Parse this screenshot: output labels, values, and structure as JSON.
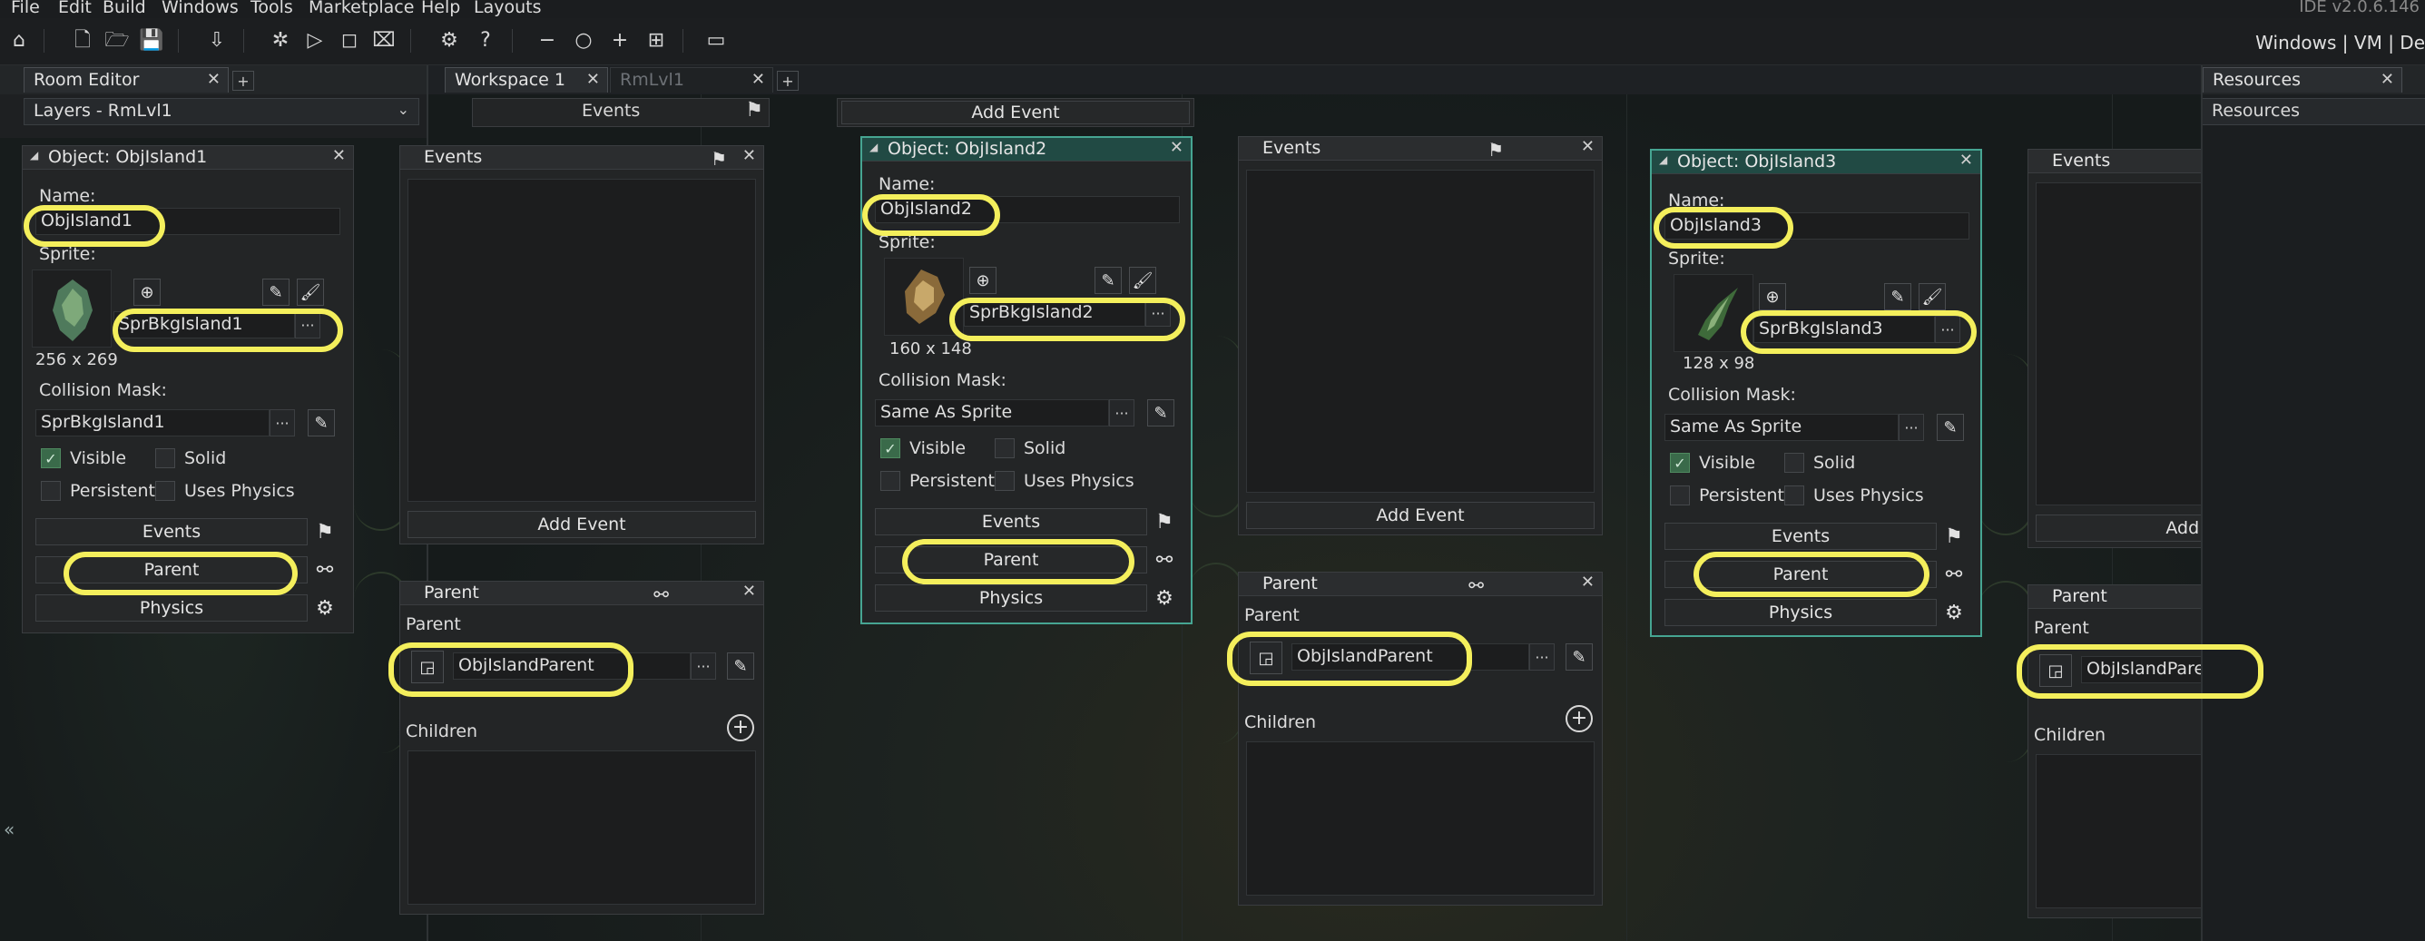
{
  "menu": {
    "items": [
      "File",
      "Edit",
      "Build",
      "Windows",
      "Tools",
      "Marketplace",
      "Help",
      "Layouts"
    ],
    "version": "IDE v2.0.6.146"
  },
  "toolbar": {
    "target": "Windows | VM | De"
  },
  "left_panel": {
    "tab_label": "Room Editor",
    "tab_add": "+",
    "layers_label": "Layers - RmLvl1",
    "collapse_glyph": "«"
  },
  "workspace_tabs": [
    {
      "label": "Workspace 1",
      "active": true
    },
    {
      "label": "RmLvl1",
      "active": false
    }
  ],
  "workspace_tab_add": "+",
  "resources": {
    "tab_label": "Resources",
    "header": "Resources"
  },
  "top_strips": {
    "events_label": "Events",
    "add_event_label": "Add Event"
  },
  "common": {
    "name_label": "Name:",
    "sprite_label": "Sprite:",
    "collision_label": "Collision Mask:",
    "visible_label": "Visible",
    "solid_label": "Solid",
    "persistent_label": "Persistent",
    "uses_physics_label": "Uses Physics",
    "events_button": "Events",
    "parent_button": "Parent",
    "physics_button": "Physics",
    "dots": "···",
    "events_window_title": "Events",
    "add_event_button": "Add Event",
    "parent_window_title": "Parent",
    "parent_label": "Parent",
    "children_label": "Children"
  },
  "objects": [
    {
      "title": "Object: ObjIsland1",
      "name": "ObjIsland1",
      "sprite": "SprBkgIsland1",
      "sprite_size": "256 x 269",
      "collision_mask": "SprBkgIsland1",
      "visible": true,
      "solid": false,
      "persistent": false,
      "uses_physics": false,
      "parent": "ObjIslandParent"
    },
    {
      "title": "Object: ObjIsland2",
      "name": "ObjIsland2",
      "sprite": "SprBkgIsland2",
      "sprite_size": "160 x 148",
      "collision_mask": "Same As Sprite",
      "visible": true,
      "solid": false,
      "persistent": false,
      "uses_physics": false,
      "parent": "ObjIslandParent"
    },
    {
      "title": "Object: ObjIsland3",
      "name": "ObjIsland3",
      "sprite": "SprBkgIsland3",
      "sprite_size": "128 x 98",
      "collision_mask": "Same As Sprite",
      "visible": true,
      "solid": false,
      "persistent": false,
      "uses_physics": false,
      "parent": "ObjIslandParent"
    }
  ],
  "colors": {
    "highlight": "#f4ef5c",
    "selected_window": "#46a592",
    "background": "#161a1b"
  }
}
